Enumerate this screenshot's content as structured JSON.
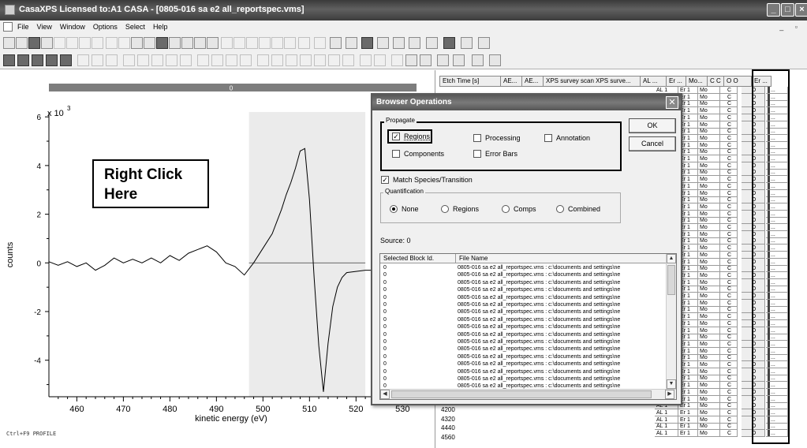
{
  "window": {
    "title": "CasaXPS Licensed to:A1 CASA - [0805-016 sa e2 all_reportspec.vms]"
  },
  "menubar": {
    "items": [
      "File",
      "View",
      "Window",
      "Options",
      "Select",
      "Help"
    ]
  },
  "graph": {
    "header_label": "0",
    "multiplier": "x 10",
    "multiplier_exp": "3",
    "annotation_line1": "Right Click",
    "annotation_line2": "Here",
    "status": "Ctrl+F9 PROFILE"
  },
  "chart_data": {
    "type": "line",
    "xlabel": "kinetic energy (eV)",
    "ylabel": "counts",
    "xlim": [
      454,
      533
    ],
    "ylim": [
      -5.5,
      6.2
    ],
    "xticks": [
      460,
      470,
      480,
      490,
      500,
      510,
      520,
      530
    ],
    "yticks": [
      6,
      4,
      2,
      0,
      -2,
      -4
    ],
    "region": [
      497,
      522
    ],
    "baseline": 0,
    "series": [
      {
        "x": [
          454,
          456,
          458,
          460,
          462,
          464,
          466,
          468,
          470,
          472,
          474,
          476,
          478,
          480,
          482,
          484,
          486,
          488,
          490,
          492,
          494,
          496,
          498,
          500,
          502,
          503,
          504,
          505,
          506,
          507,
          508,
          509,
          510,
          511,
          512,
          513,
          514,
          515,
          516,
          517,
          518,
          520,
          522,
          524,
          526,
          528,
          530
        ],
        "y": [
          0.05,
          -0.1,
          0.05,
          -0.15,
          0.0,
          -0.3,
          -0.1,
          0.2,
          0.0,
          0.15,
          0.0,
          0.2,
          0.0,
          0.3,
          0.1,
          0.4,
          0.55,
          0.7,
          0.45,
          0.0,
          -0.15,
          -0.5,
          0.0,
          0.6,
          1.2,
          1.7,
          2.2,
          2.8,
          3.3,
          3.9,
          4.6,
          4.7,
          2.6,
          -0.6,
          -3.4,
          -5.3,
          -3.3,
          -1.8,
          -1.0,
          -0.6,
          -0.4,
          -0.35,
          -0.3,
          -0.3,
          -0.35,
          -0.3,
          -0.3
        ]
      }
    ]
  },
  "table": {
    "columns": [
      "Etch Time [s]",
      "AE...",
      "AE...",
      "XPS survey scan XPS surve...",
      "AL ...",
      "Er ...",
      "Mo...",
      "C C",
      "O O",
      "Er ..."
    ],
    "etch_times": [
      "4200",
      "4320",
      "4440",
      "4560"
    ],
    "row_values": {
      "al": "AL 1",
      "er": "Er 1",
      "mo": "Mo",
      "c": "C",
      "o": "O",
      "e": "Er ..."
    }
  },
  "dialog": {
    "title": "Browser Operations",
    "propagate_label": "Propagate",
    "regions": "Regions",
    "processing": "Processing",
    "annotation": "Annotation",
    "components": "Components",
    "error_bars": "Error Bars",
    "ok": "OK",
    "cancel": "Cancel",
    "match_species": "Match Species/Transition",
    "quantification_label": "Quantification",
    "q_none": "None",
    "q_regions": "Regions",
    "q_comps": "Comps",
    "q_combined": "Combined",
    "source": "Source: 0",
    "list_headers": [
      "Selected Block Id.",
      "File Name"
    ],
    "list_rows": [
      {
        "id": "0",
        "file": "0805-016 sa e2 all_reportspec.vms : c:\\documents and settings\\ne"
      },
      {
        "id": "0",
        "file": "0805-016 sa e2 all_reportspec.vms : c:\\documents and settings\\ne"
      },
      {
        "id": "0",
        "file": "0805-016 sa e2 all_reportspec.vms : c:\\documents and settings\\ne"
      },
      {
        "id": "0",
        "file": "0805-016 sa e2 all_reportspec.vms : c:\\documents and settings\\ne"
      },
      {
        "id": "0",
        "file": "0805-016 sa e2 all_reportspec.vms : c:\\documents and settings\\ne"
      },
      {
        "id": "0",
        "file": "0805-016 sa e2 all_reportspec.vms : c:\\documents and settings\\ne"
      },
      {
        "id": "0",
        "file": "0805-016 sa e2 all_reportspec.vms : c:\\documents and settings\\ne"
      },
      {
        "id": "0",
        "file": "0805-016 sa e2 all_reportspec.vms : c:\\documents and settings\\ne"
      },
      {
        "id": "0",
        "file": "0805-016 sa e2 all_reportspec.vms : c:\\documents and settings\\ne"
      },
      {
        "id": "0",
        "file": "0805-016 sa e2 all_reportspec.vms : c:\\documents and settings\\ne"
      },
      {
        "id": "0",
        "file": "0805-016 sa e2 all_reportspec.vms : c:\\documents and settings\\ne"
      },
      {
        "id": "0",
        "file": "0805-016 sa e2 all_reportspec.vms : c:\\documents and settings\\ne"
      },
      {
        "id": "0",
        "file": "0805-016 sa e2 all_reportspec.vms : c:\\documents and settings\\ne"
      },
      {
        "id": "0",
        "file": "0805-016 sa e2 all_reportspec.vms : c:\\documents and settings\\ne"
      },
      {
        "id": "0",
        "file": "0805-016 sa e2 all_reportspec.vms : c:\\documents and settings\\ne"
      },
      {
        "id": "0",
        "file": "0805-016 sa e2 all_reportspec.vms : c:\\documents and settings\\ne"
      },
      {
        "id": "0",
        "file": "0805-016 sa e2 all_reportspec.vms : c:\\documents and settings\\ne"
      }
    ]
  }
}
